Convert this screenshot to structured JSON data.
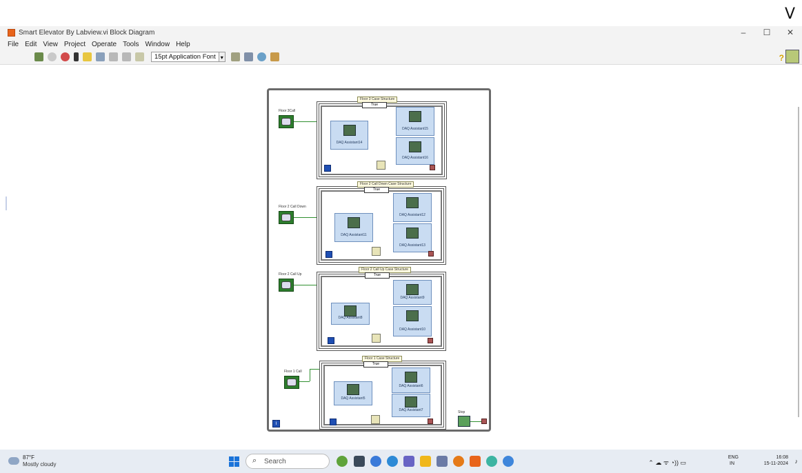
{
  "corner_text": "V",
  "window": {
    "title": "Smart Elevator By Labview.vi Block Diagram",
    "controls": {
      "minimize": "–",
      "restore": "☐",
      "close": "✕"
    }
  },
  "menu": [
    "File",
    "Edit",
    "View",
    "Project",
    "Operate",
    "Tools",
    "Window",
    "Help"
  ],
  "toolbar": {
    "font_select": "15pt Application Font",
    "dropdown_arrow": "▾"
  },
  "diagram": {
    "cases": [
      {
        "label": "Floor 3 Case Structure",
        "selector": "True",
        "control_label": "Floor 3Call",
        "daq_left": "DAQ Assistant14",
        "daq_right_top": "DAQ Assistant15",
        "daq_right_bottom": "DAQ Assistant16"
      },
      {
        "label": "Floor 2 Call Down Case Structure",
        "selector": "True",
        "control_label": "Floor 2 Call Down",
        "daq_left": "DAQ Assistant11",
        "daq_right_top": "DAQ Assistant12",
        "daq_right_bottom": "DAQ Assistant13"
      },
      {
        "label": "Floor 2 Call Up Case Structure",
        "selector": "True",
        "control_label": "Floor 2 Call Up",
        "daq_left": "DAQ Assistant8",
        "daq_right_top": "DAQ Assistant9",
        "daq_right_bottom": "DAQ Assistant10"
      },
      {
        "label": "Floor 1 Case Structure",
        "selector": "True",
        "control_label": "Floor 1 Call",
        "daq_left": "DAQ Assistant5",
        "daq_right_top": "DAQ Assistant6",
        "daq_right_bottom": "DAQ Assistant7"
      }
    ],
    "stop_label": "Stop",
    "iteration_glyph": "i"
  },
  "taskbar": {
    "weather_temp": "87°F",
    "weather_desc": "Mostly cloudy",
    "search_placeholder": "Search",
    "search_glyph": "⌕",
    "lang_top": "ENG",
    "lang_bottom": "IN",
    "time": "16:08",
    "date": "15-11-2024",
    "tray_glyphs": "⌃  ☁   ᯤ ◔)) ▭"
  },
  "colors": {
    "daq_fill": "#c9dcf2",
    "control_green": "#2d7d2d",
    "wire_green": "#2f8f2f",
    "loop_border": "#6a6a6a"
  }
}
